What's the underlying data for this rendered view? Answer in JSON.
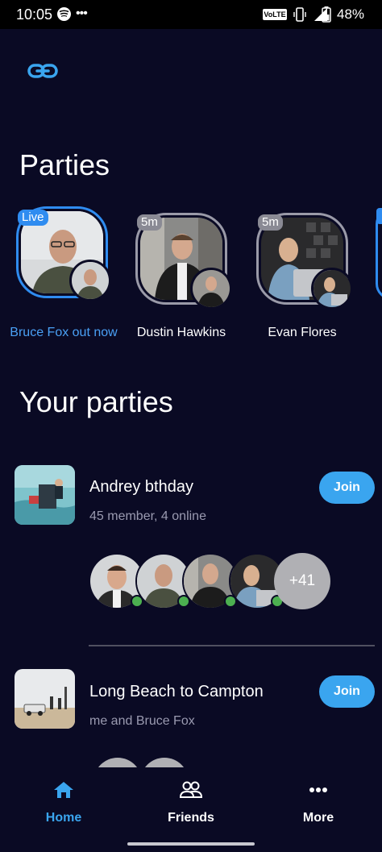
{
  "status_bar": {
    "time": "10:05",
    "network_badge": "VoLTE",
    "battery": "48%",
    "icons": [
      "spotify-icon",
      "more-dots-icon",
      "vibrate-icon",
      "lte-signal-icon",
      "battery-icon"
    ]
  },
  "header": {
    "link_icon": "link-icon",
    "parties_title": "Parties",
    "your_parties_title": "Your parties"
  },
  "stories": [
    {
      "badge": "Live",
      "name": "Bruce Fox out now",
      "live": true
    },
    {
      "badge": "5m",
      "name": "Dustin Hawkins",
      "live": false
    },
    {
      "badge": "5m",
      "name": "Evan Flores",
      "live": false
    }
  ],
  "parties": [
    {
      "name": "Andrey bthday",
      "subtitle": "45 member, 4 online",
      "join_label": "Join",
      "extra_members": "+41"
    },
    {
      "name": "Long Beach to Campton",
      "subtitle": "me and Bruce Fox",
      "join_label": "Join"
    }
  ],
  "bottom_nav": {
    "items": [
      {
        "label": "Home",
        "icon": "home-icon",
        "active": true
      },
      {
        "label": "Friends",
        "icon": "friends-icon",
        "active": false
      },
      {
        "label": "More",
        "icon": "more-icon",
        "active": false
      }
    ]
  },
  "colors": {
    "background": "#0a0a24",
    "accent": "#3aa5ef",
    "live_ring": "#2f8cf0",
    "online": "#4cb050"
  }
}
